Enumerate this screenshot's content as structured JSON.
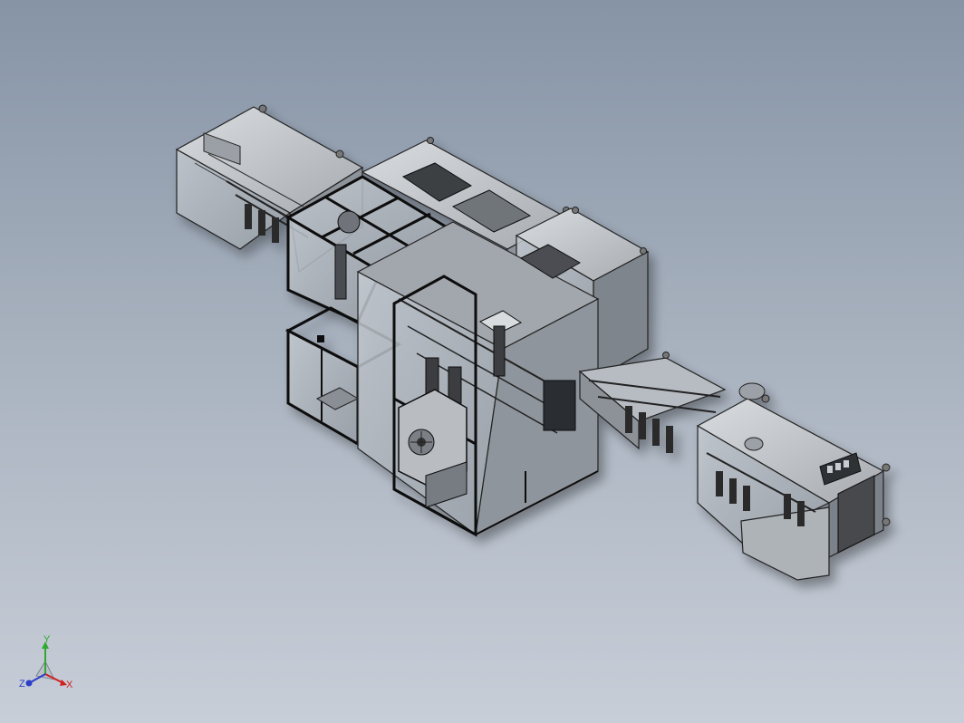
{
  "viewport": {
    "background_top": "#8694a6",
    "background_bottom": "#c8ced8"
  },
  "model": {
    "frame_color": "#1a1a1a",
    "panel_color": "#9ea3a8",
    "glass_color": "#b7bdc4",
    "steel_color": "#6c7075"
  },
  "triad": {
    "y_label": "Y",
    "z_label": "Z",
    "x_label": "X",
    "y_color": "#2fa82f",
    "z_color": "#2a3fc8",
    "x_color": "#d02020"
  }
}
